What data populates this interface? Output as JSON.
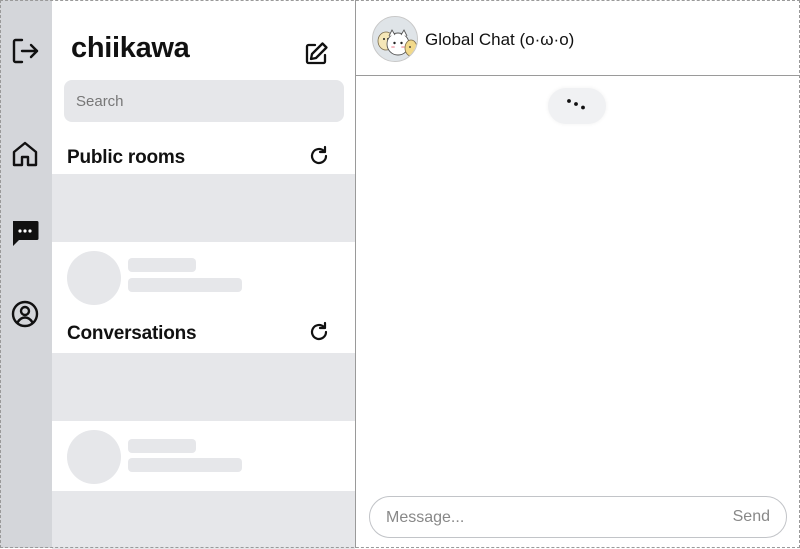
{
  "rail": {
    "icons": [
      "logout-icon",
      "home-icon",
      "chat-icon",
      "profile-icon"
    ],
    "active_bg": "#d4d6da"
  },
  "sidebar": {
    "username": "chiikawa",
    "search_placeholder": "Search",
    "sections": [
      {
        "title": "Public rooms"
      },
      {
        "title": "Conversations"
      }
    ]
  },
  "chat": {
    "room_name": "Global Chat (o·ω·o)",
    "message_placeholder": "Message...",
    "send_label": "Send"
  }
}
